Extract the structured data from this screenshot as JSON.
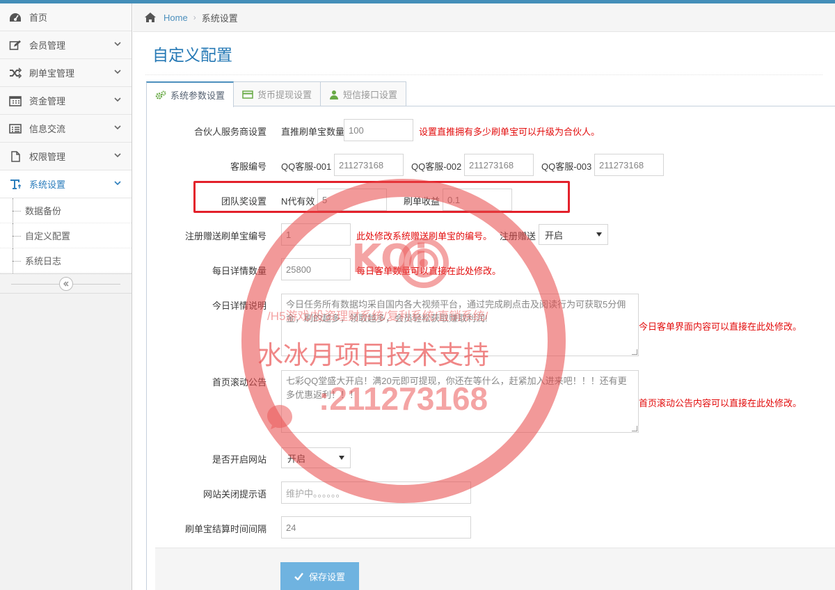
{
  "sidebar": {
    "items": [
      {
        "label": "首页",
        "icon": "dashboard-icon"
      },
      {
        "label": "会员管理",
        "icon": "edit-icon"
      },
      {
        "label": "刷单宝管理",
        "icon": "random-icon"
      },
      {
        "label": "资金管理",
        "icon": "calendar-icon"
      },
      {
        "label": "信息交流",
        "icon": "list-icon"
      },
      {
        "label": "权限管理",
        "icon": "file-icon"
      },
      {
        "label": "系统设置",
        "icon": "text-icon"
      }
    ],
    "sub_items": [
      {
        "label": "数据备份"
      },
      {
        "label": "自定义配置"
      },
      {
        "label": "系统日志"
      }
    ]
  },
  "breadcrumb": {
    "home": "Home",
    "current": "系统设置"
  },
  "page": {
    "title": "自定义配置"
  },
  "tabs": [
    {
      "label": "系统参数设置"
    },
    {
      "label": "货币提现设置"
    },
    {
      "label": "短信接口设置"
    }
  ],
  "form": {
    "partner": {
      "label": "合伙人服务商设置",
      "prefix": "直推刷单宝数量",
      "value": "100",
      "help": "设置直推拥有多少刷单宝可以升级为合伙人。"
    },
    "service": {
      "label": "客服编号",
      "fields": [
        {
          "prefix": "QQ客服-001",
          "value": "211273168"
        },
        {
          "prefix": "QQ客服-002",
          "value": "211273168"
        },
        {
          "prefix": "QQ客服-003",
          "value": "211273168"
        }
      ]
    },
    "team": {
      "label": "团队奖设置",
      "n_prefix": "N代有效",
      "n_value": "5",
      "income_prefix": "刷单收益",
      "income_value": "0.1"
    },
    "register": {
      "label": "注册赠送刷单宝编号",
      "value": "1",
      "help": "此处修改系统赠送刷单宝的编号。",
      "gift_label": "注册赠送",
      "gift_select": "开启"
    },
    "daily_count": {
      "label": "每日详情数量",
      "value": "25800",
      "help": "每日客单数量可以直接在此处修改。"
    },
    "today_desc": {
      "label": "今日详情说明",
      "value": "今日任务所有数据均采自国内各大视频平台，通过完成刷点击及阅读行为可获取5分佣金，刷的越多，领取越多，会员轻松获取赚取利润!",
      "help": "今日客单界面内容可以直接在此处修改。"
    },
    "notice": {
      "label": "首页滚动公告",
      "value": "七彩QQ堂盛大开启！满20元即可提现，你还在等什么，赶紧加入进来吧！！！还有更多优惠返利！！！",
      "help": "首页滚动公告内容可以直接在此处修改。"
    },
    "site_open": {
      "label": "是否开启网站",
      "select": "开启"
    },
    "close_tip": {
      "label": "网站关闭提示语",
      "placeholder": "维护中。。。。。。"
    },
    "interval": {
      "label": "刷单宝结算时间间隔",
      "value": "24"
    },
    "save_label": "保存设置"
  },
  "watermark": {
    "logo": "KOi",
    "line1": "/H5游戏/投资理财系统/复利系统/直销系统/",
    "line2": "水冰月项目技术支持",
    "contact": ":211273168"
  }
}
